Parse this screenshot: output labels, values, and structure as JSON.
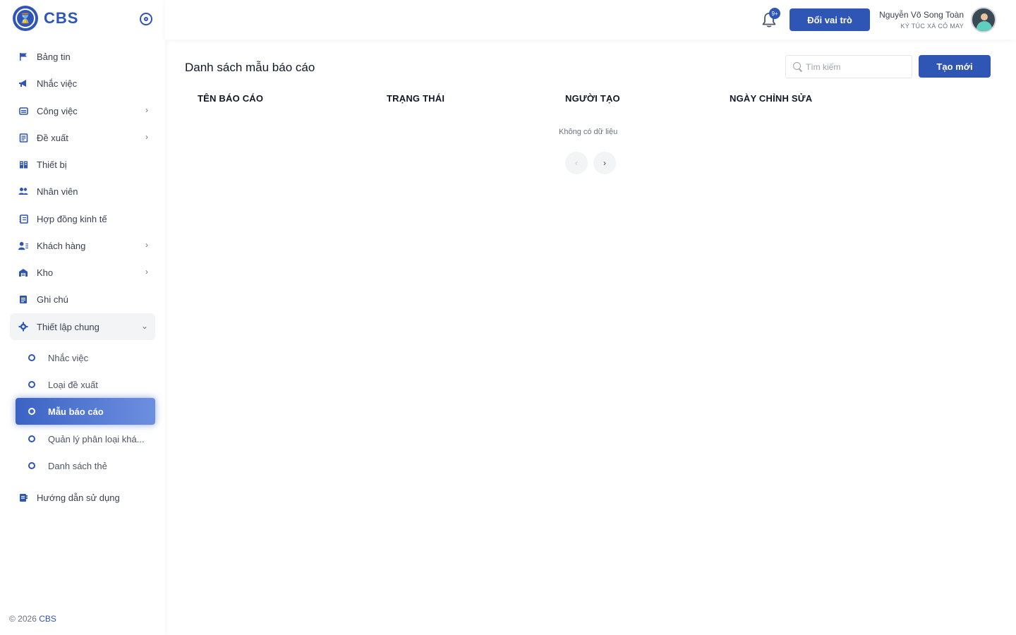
{
  "sidebar": {
    "brand": "CBS",
    "menu": [
      {
        "label": "Bảng tin",
        "icon": "flag-icon",
        "expandable": false
      },
      {
        "label": "Nhắc việc",
        "icon": "megaphone-icon",
        "expandable": false
      },
      {
        "label": "Công việc",
        "icon": "briefcase-icon",
        "expandable": true
      },
      {
        "label": "Đề xuất",
        "icon": "clipboard-icon",
        "expandable": true
      },
      {
        "label": "Thiết bị",
        "icon": "devices-icon",
        "expandable": false
      },
      {
        "label": "Nhân viên",
        "icon": "people-icon",
        "expandable": false
      },
      {
        "label": "Hợp đồng kinh tế",
        "icon": "contract-icon",
        "expandable": false
      },
      {
        "label": "Khách hàng",
        "icon": "customer-icon",
        "expandable": true
      },
      {
        "label": "Kho",
        "icon": "warehouse-icon",
        "expandable": true
      },
      {
        "label": "Ghi chú",
        "icon": "note-icon",
        "expandable": false
      },
      {
        "label": "Thiết lập chung",
        "icon": "gear-icon",
        "expandable": true,
        "open": true
      }
    ],
    "submenu": [
      {
        "label": "Nhắc việc",
        "active": false
      },
      {
        "label": "Loại đề xuất",
        "active": false
      },
      {
        "label": "Mẫu báo cáo",
        "active": true
      },
      {
        "label": "Quản lý phân loại khá...",
        "active": false
      },
      {
        "label": "Danh sách thẻ",
        "active": false
      }
    ],
    "guide": {
      "label": "Hướng dẫn sử dụng",
      "icon": "guide-icon"
    },
    "footer": {
      "copyright": "© 2026",
      "brand": "CBS"
    }
  },
  "header": {
    "notification_badge": "9+",
    "switch_role_label": "Đổi vai trò",
    "user_name": "Nguyễn Võ Song Toàn",
    "user_org": "KÝ TÚC XÁ CỎ MAY"
  },
  "main": {
    "title": "Danh sách mẫu báo cáo",
    "search_placeholder": "Tìm kiếm",
    "create_label": "Tạo mới",
    "columns": [
      "TÊN BÁO CÁO",
      "TRẠNG THÁI",
      "NGƯỜI TẠO",
      "NGÀY CHỈNH SỬA"
    ],
    "empty_text": "Không có dữ liệu"
  },
  "colors": {
    "primary": "#2f55b5",
    "active_gradient_end": "#6d8fe0"
  }
}
